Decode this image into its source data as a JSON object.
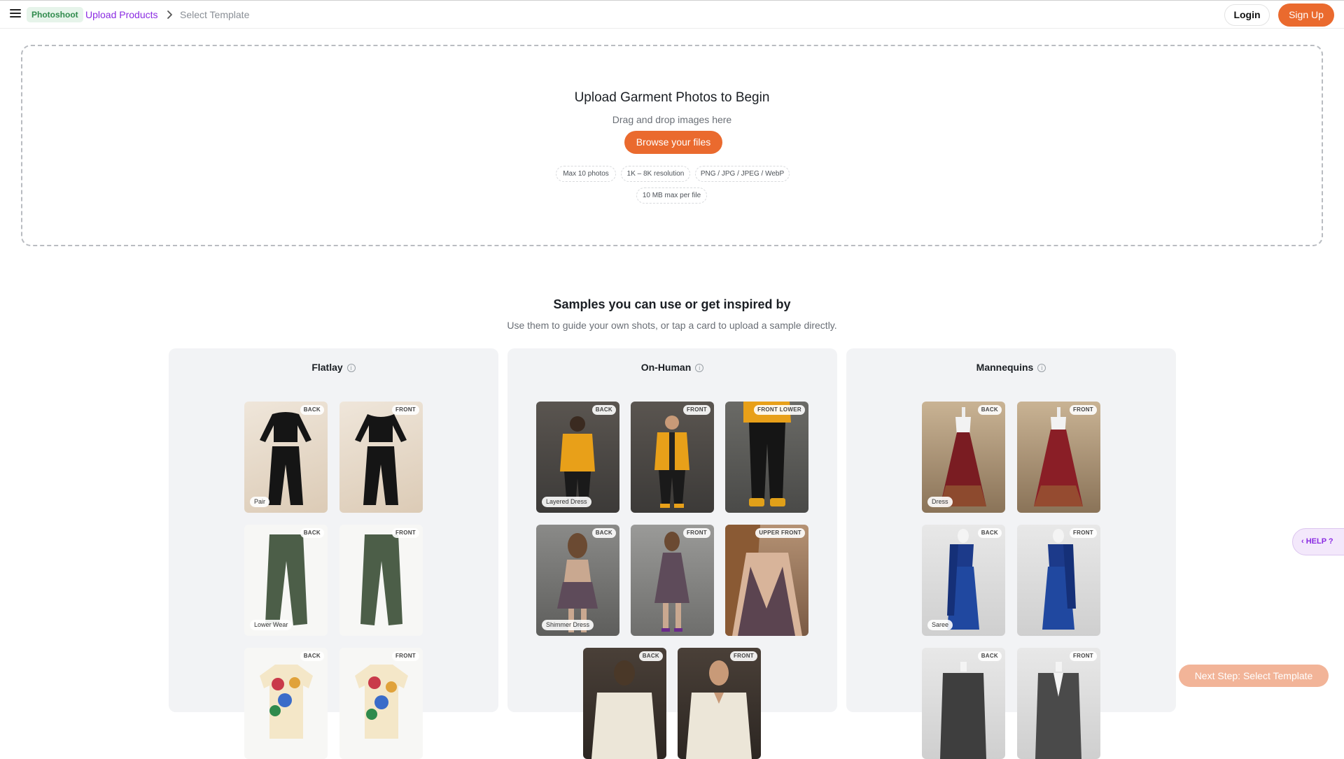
{
  "header": {
    "tag": "Photoshoot",
    "breadcrumb_current": "Upload Products",
    "breadcrumb_next": "Select Template",
    "login_label": "Login",
    "signup_label": "Sign Up"
  },
  "upload": {
    "title": "Upload Garment Photos to Begin",
    "subtitle": "Drag and drop images here",
    "browse_label": "Browse your files",
    "chips": [
      "Max 10 photos",
      "1K – 8K resolution",
      "PNG / JPG / JPEG / WebP",
      "10 MB max per file"
    ]
  },
  "samples": {
    "title": "Samples you can use or get inspired by",
    "subtitle": "Use them to guide your own shots, or tap a card to upload a sample directly."
  },
  "panels": [
    {
      "title": "Flatlay",
      "cards": [
        {
          "badge": "BACK",
          "label": "Pair"
        },
        {
          "badge": "FRONT",
          "label": ""
        },
        {
          "badge": "BACK",
          "label": "Lower Wear"
        },
        {
          "badge": "FRONT",
          "label": ""
        },
        {
          "badge": "BACK",
          "label": ""
        },
        {
          "badge": "FRONT",
          "label": ""
        }
      ]
    },
    {
      "title": "On-Human",
      "cards": [
        {
          "badge": "BACK",
          "label": "Layered Dress"
        },
        {
          "badge": "FRONT",
          "label": ""
        },
        {
          "badge": "FRONT LOWER",
          "label": ""
        },
        {
          "badge": "BACK",
          "label": "Shimmer Dress"
        },
        {
          "badge": "FRONT",
          "label": ""
        },
        {
          "badge": "UPPER FRONT",
          "label": ""
        },
        {
          "badge": "BACK",
          "label": ""
        },
        {
          "badge": "FRONT",
          "label": ""
        }
      ]
    },
    {
      "title": "Mannequins",
      "cards": [
        {
          "badge": "BACK",
          "label": "Dress"
        },
        {
          "badge": "FRONT",
          "label": ""
        },
        {
          "badge": "BACK",
          "label": "Saree"
        },
        {
          "badge": "FRONT",
          "label": ""
        },
        {
          "badge": "BACK",
          "label": ""
        },
        {
          "badge": "FRONT",
          "label": ""
        }
      ]
    }
  ],
  "help_label": "HELP ?",
  "next_step_label": "Next Step: Select Template",
  "colors": {
    "accent": "#ea6a2e",
    "breadcrumb": "#8a2be2",
    "tag_bg": "#e6f4ea",
    "tag_text": "#2f8a4c"
  }
}
